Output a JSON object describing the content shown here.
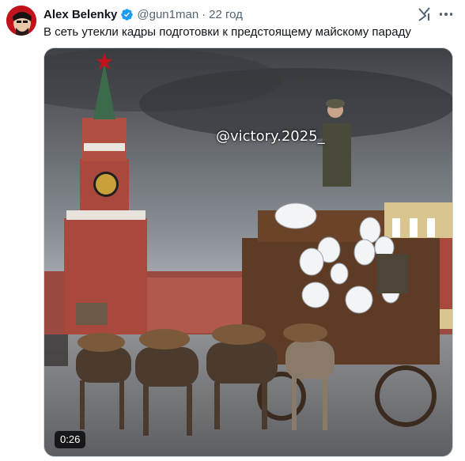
{
  "author": {
    "name": "Alex Belenky",
    "handle": "@gun1man",
    "separator": "·",
    "time": "22 год"
  },
  "post": {
    "text": "В сеть утекли кадры подготовки к предстоящему майскому параду"
  },
  "media": {
    "watermark": "@victory.2025_",
    "duration": "0:26"
  },
  "icons": {
    "verified": "verified-badge-icon",
    "grok": "grok-icon",
    "more": "more-dots-icon"
  },
  "colors": {
    "accent": "#1d9bf0",
    "secondary_text": "#536471",
    "primary_text": "#0f1419"
  }
}
